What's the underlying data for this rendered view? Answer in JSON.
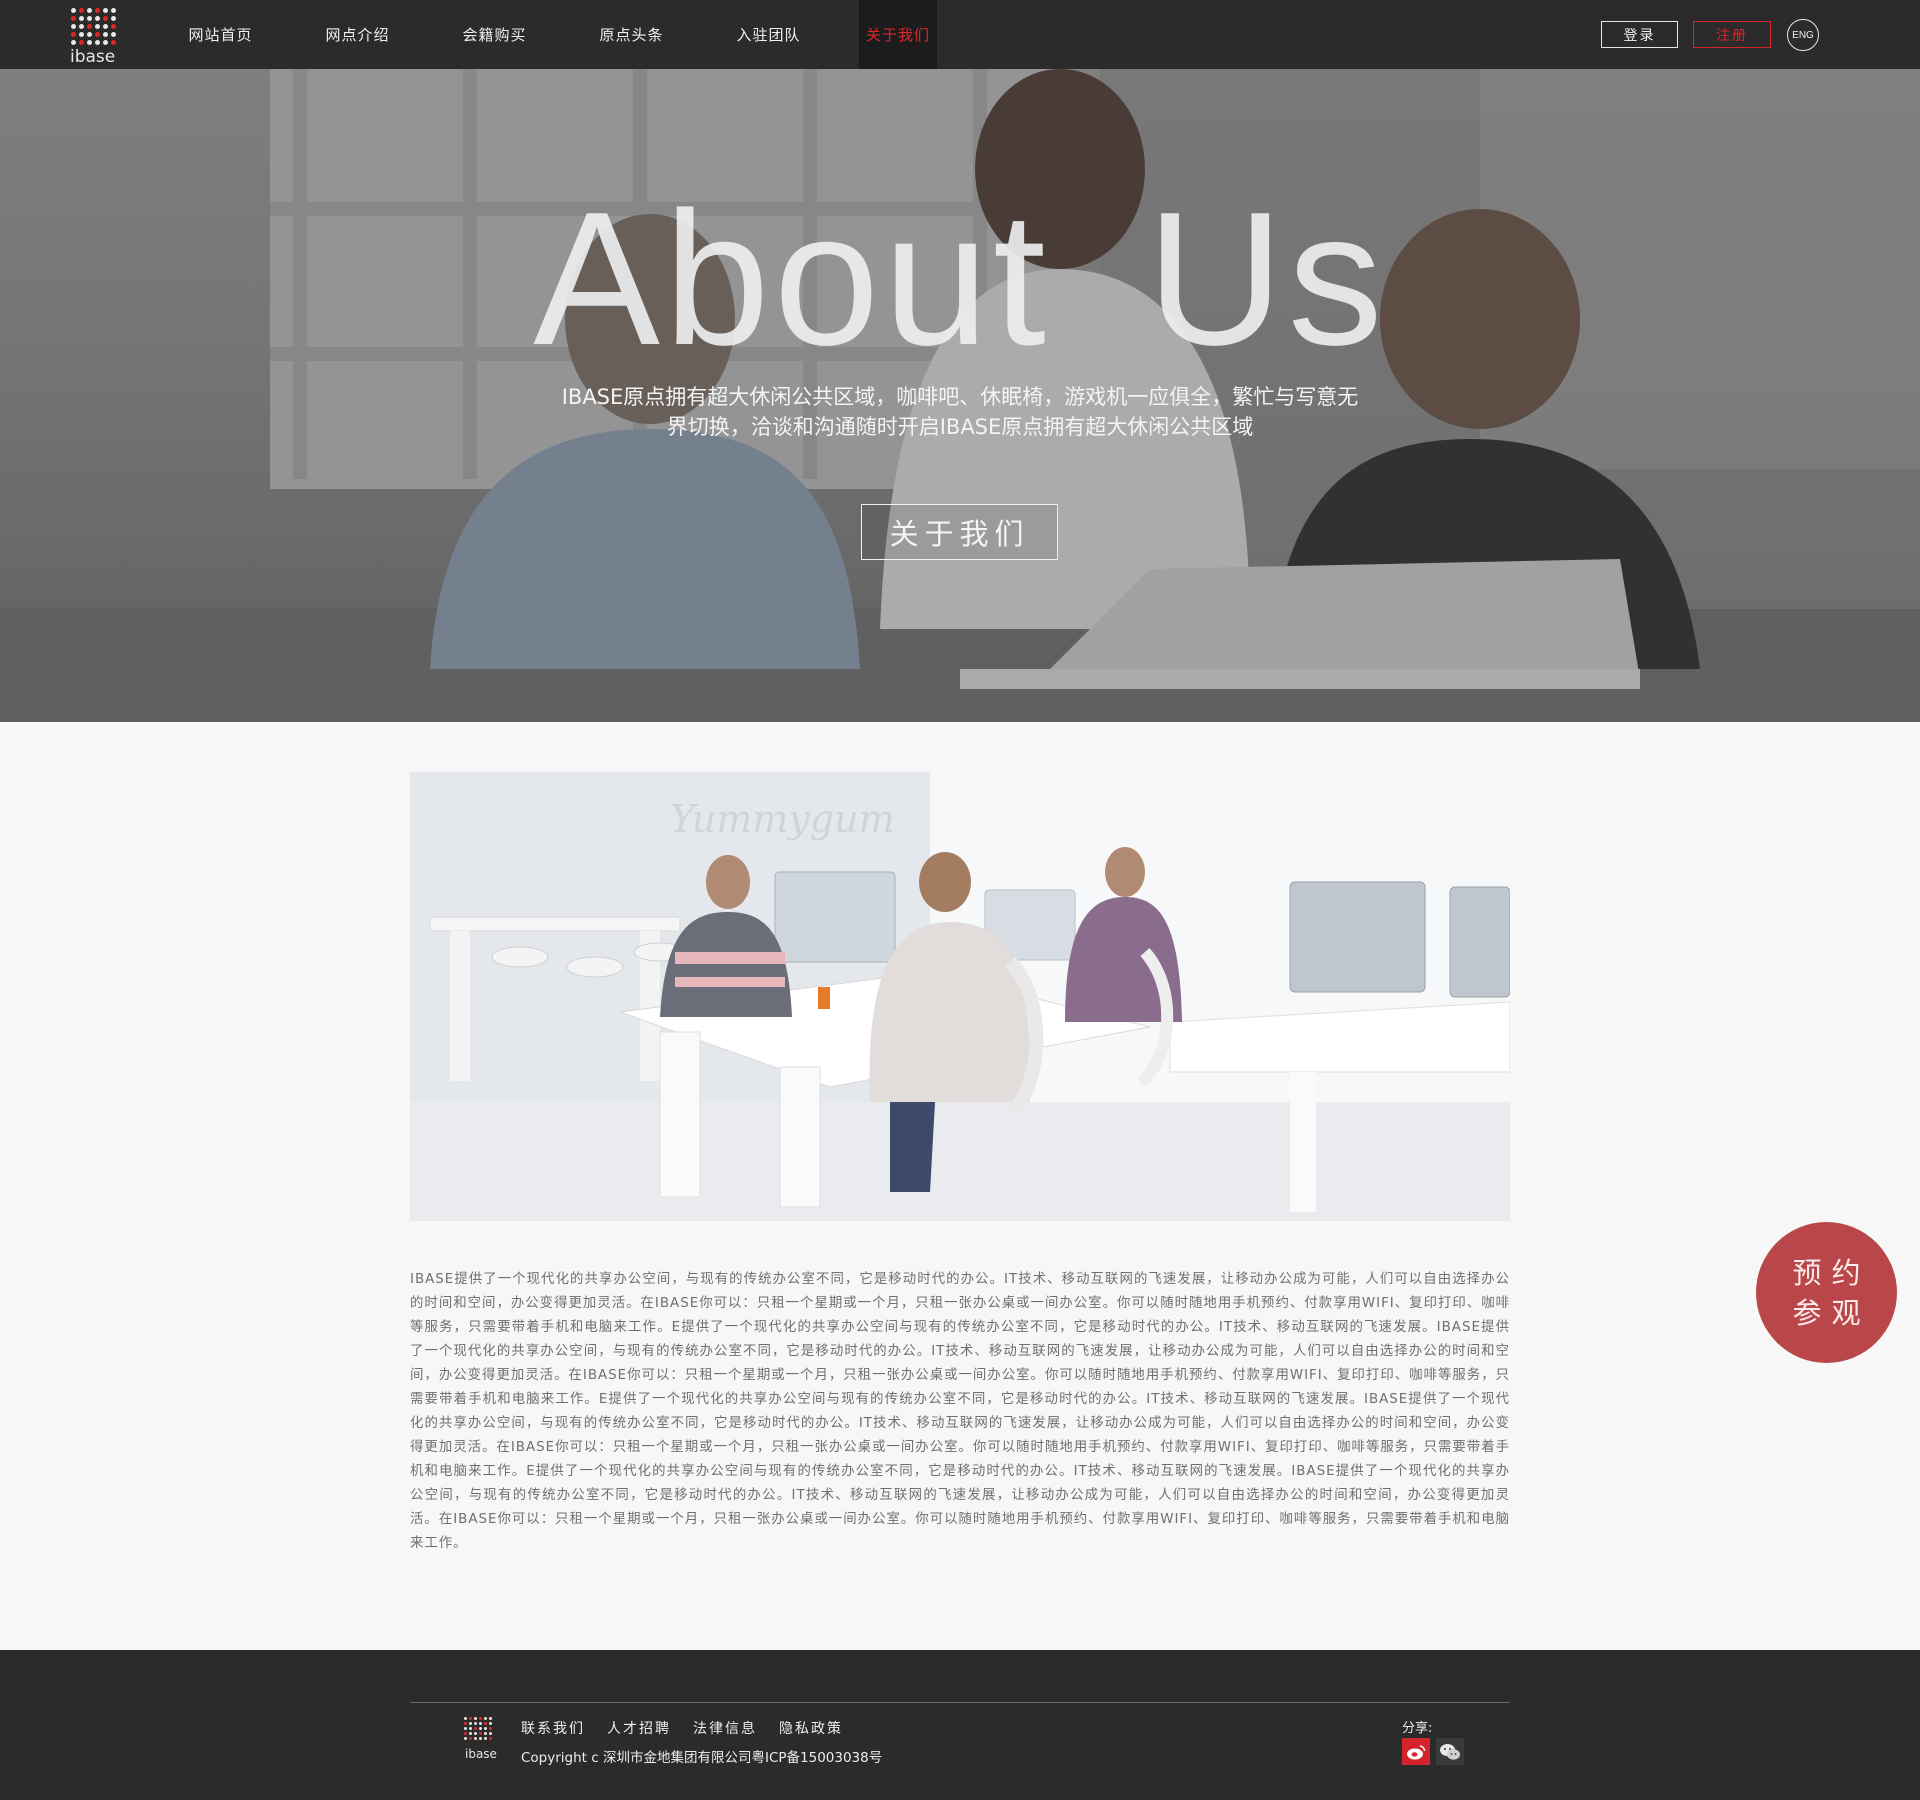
{
  "nav": {
    "logo_text": "ibase",
    "items": [
      {
        "label": "网站首页"
      },
      {
        "label": "网点介绍"
      },
      {
        "label": "会籍购买"
      },
      {
        "label": "原点头条"
      },
      {
        "label": "入驻团队"
      },
      {
        "label": "关于我们"
      }
    ],
    "active_index": 5,
    "login_label": "登录",
    "register_label": "注册",
    "lang_label": "ENG"
  },
  "hero": {
    "title": "About Us",
    "description": "IBASE原点拥有超大休闲公共区域，咖啡吧、休眠椅，游戏机一应俱全，繁忙与写意无界切换，洽谈和沟通随时开启IBASE原点拥有超大休闲公共区域",
    "button_label": "关于我们"
  },
  "content": {
    "photo_sign_text": "Yummygum",
    "article": "IBASE提供了一个现代化的共享办公空间，与现有的传统办公室不同，它是移动时代的办公。IT技术、移动互联网的飞速发展，让移动办公成为可能，人们可以自由选择办公的时间和空间，办公变得更加灵活。在IBASE你可以：只租一个星期或一个月，只租一张办公桌或一间办公室。你可以随时随地用手机预约、付款享用WIFI、复印打印、咖啡等服务，只需要带着手机和电脑来工作。E提供了一个现代化的共享办公空间与现有的传统办公室不同，它是移动时代的办公。IT技术、移动互联网的飞速发展。IBASE提供了一个现代化的共享办公空间，与现有的传统办公室不同，它是移动时代的办公。IT技术、移动互联网的飞速发展，让移动办公成为可能，人们可以自由选择办公的时间和空间，办公变得更加灵活。在IBASE你可以：只租一个星期或一个月，只租一张办公桌或一间办公室。你可以随时随地用手机预约、付款享用WIFI、复印打印、咖啡等服务，只需要带着手机和电脑来工作。E提供了一个现代化的共享办公空间与现有的传统办公室不同，它是移动时代的办公。IT技术、移动互联网的飞速发展。IBASE提供了一个现代化的共享办公空间，与现有的传统办公室不同，它是移动时代的办公。IT技术、移动互联网的飞速发展，让移动办公成为可能，人们可以自由选择办公的时间和空间，办公变得更加灵活。在IBASE你可以：只租一个星期或一个月，只租一张办公桌或一间办公室。你可以随时随地用手机预约、付款享用WIFI、复印打印、咖啡等服务，只需要带着手机和电脑来工作。E提供了一个现代化的共享办公空间与现有的传统办公室不同，它是移动时代的办公。IT技术、移动互联网的飞速发展。IBASE提供了一个现代化的共享办公空间，与现有的传统办公室不同，它是移动时代的办公。IT技术、移动互联网的飞速发展，让移动办公成为可能，人们可以自由选择办公的时间和空间，办公变得更加灵活。在IBASE你可以：只租一个星期或一个月，只租一张办公桌或一间办公室。你可以随时随地用手机预约、付款享用WIFI、复印打印、咖啡等服务，只需要带着手机和电脑来工作。"
  },
  "float_button": {
    "line1": "预约",
    "line2": "参观"
  },
  "footer": {
    "links": [
      {
        "label": "联系我们"
      },
      {
        "label": "人才招聘"
      },
      {
        "label": "法律信息"
      },
      {
        "label": "隐私政策"
      }
    ],
    "copyright": "Copyright c 深圳市金地集团有限公司粤ICP备15003038号",
    "share_label": "分享:",
    "share_icons": [
      "weibo-icon",
      "wechat-icon"
    ]
  },
  "colors": {
    "accent": "#e0262b",
    "nav_bg": "#2b2b2b",
    "float_bg": "#b9474a"
  }
}
